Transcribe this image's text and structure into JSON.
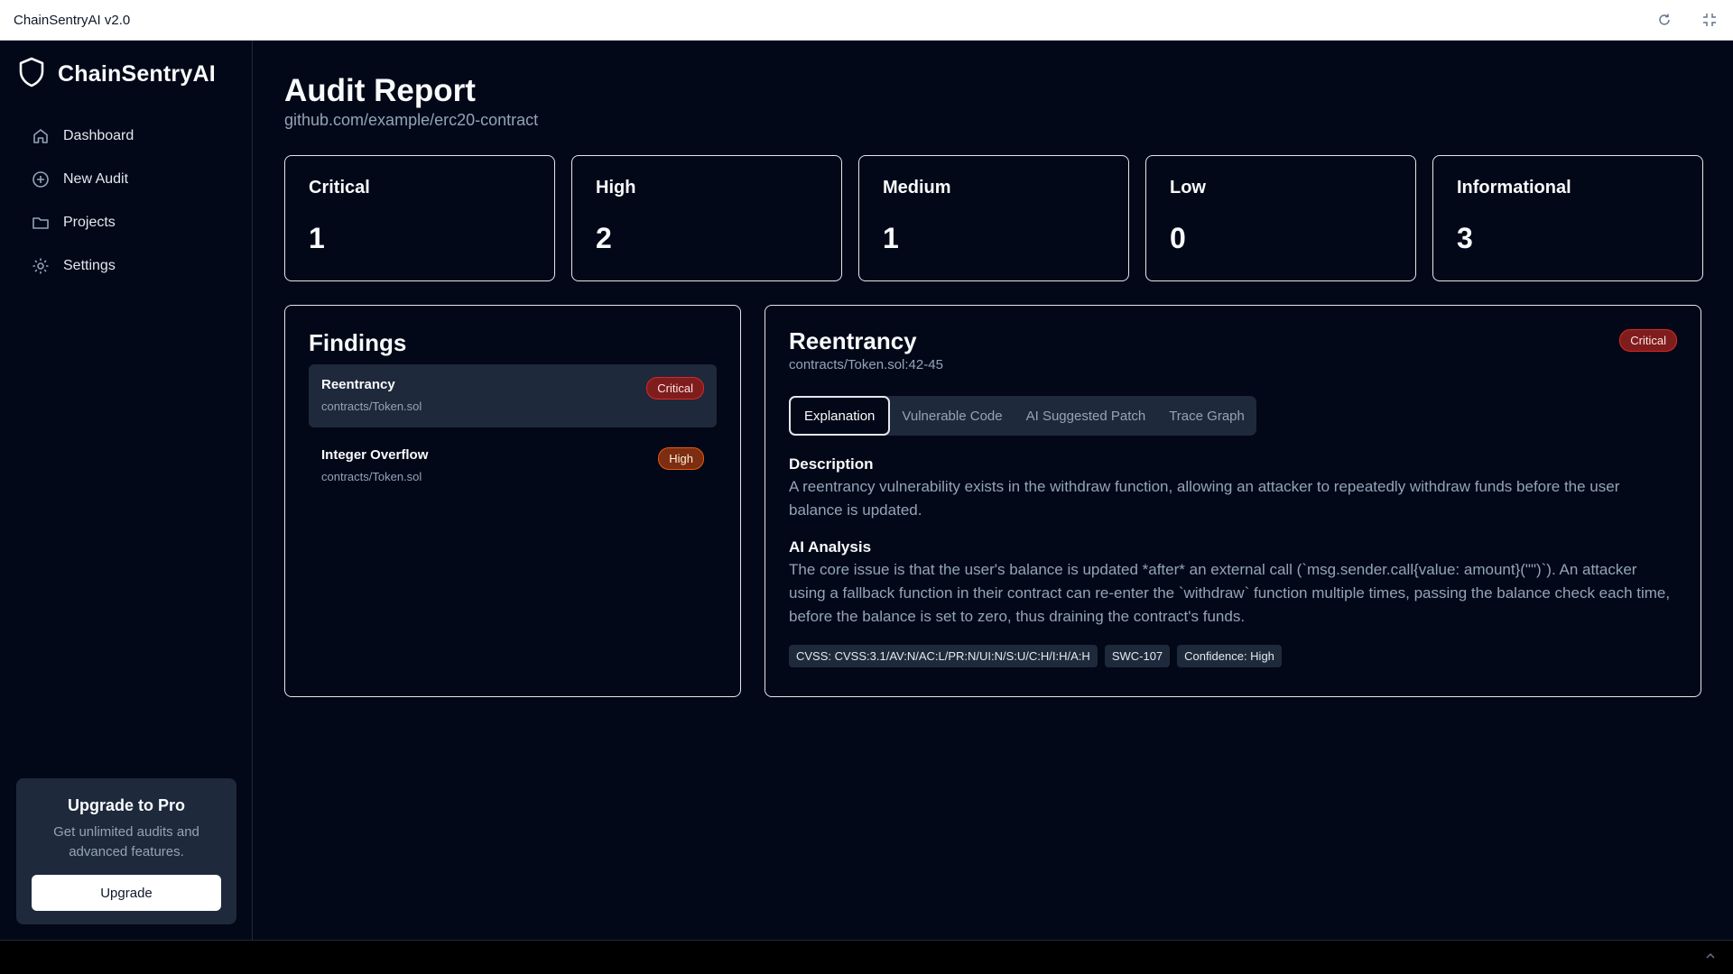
{
  "window": {
    "title": "ChainSentryAI v2.0"
  },
  "sidebar": {
    "brand": "ChainSentryAI",
    "items": [
      {
        "label": "Dashboard",
        "icon": "home-icon"
      },
      {
        "label": "New Audit",
        "icon": "plus-circle-icon"
      },
      {
        "label": "Projects",
        "icon": "folder-icon"
      },
      {
        "label": "Settings",
        "icon": "gear-icon"
      }
    ],
    "upgrade": {
      "title": "Upgrade to Pro",
      "text": "Get unlimited audits and advanced features.",
      "button": "Upgrade"
    }
  },
  "main": {
    "title": "Audit Report",
    "subtitle": "github.com/example/erc20-contract",
    "stats": [
      {
        "label": "Critical",
        "value": "1"
      },
      {
        "label": "High",
        "value": "2"
      },
      {
        "label": "Medium",
        "value": "1"
      },
      {
        "label": "Low",
        "value": "0"
      },
      {
        "label": "Informational",
        "value": "3"
      }
    ],
    "findings": {
      "title": "Findings",
      "items": [
        {
          "title": "Reentrancy",
          "path": "contracts/Token.sol",
          "severity": "Critical"
        },
        {
          "title": "Integer Overflow",
          "path": "contracts/Token.sol",
          "severity": "High"
        }
      ]
    },
    "detail": {
      "title": "Reentrancy",
      "path": "contracts/Token.sol:42-45",
      "severity": "Critical",
      "tabs": [
        "Explanation",
        "Vulnerable Code",
        "AI Suggested Patch",
        "Trace Graph"
      ],
      "description_heading": "Description",
      "description": "A reentrancy vulnerability exists in the withdraw function, allowing an attacker to repeatedly withdraw funds before the user balance is updated.",
      "analysis_heading": "AI Analysis",
      "analysis": "The core issue is that the user's balance is updated *after* an external call (`msg.sender.call{value: amount}(\"\")`). An attacker using a fallback function in their contract can re-enter the `withdraw` function multiple times, passing the balance check each time, before the balance is set to zero, thus draining the contract's funds.",
      "tags": [
        "CVSS: CVSS:3.1/AV:N/AC:L/PR:N/UI:N/S:U/C:H/I:H/A:H",
        "SWC-107",
        "Confidence: High"
      ]
    }
  },
  "colors": {
    "background": "#020817",
    "card": "#1e293b",
    "critical": "#7f1d1d",
    "high": "#7c2d12",
    "muted_text": "#94a3b8"
  }
}
